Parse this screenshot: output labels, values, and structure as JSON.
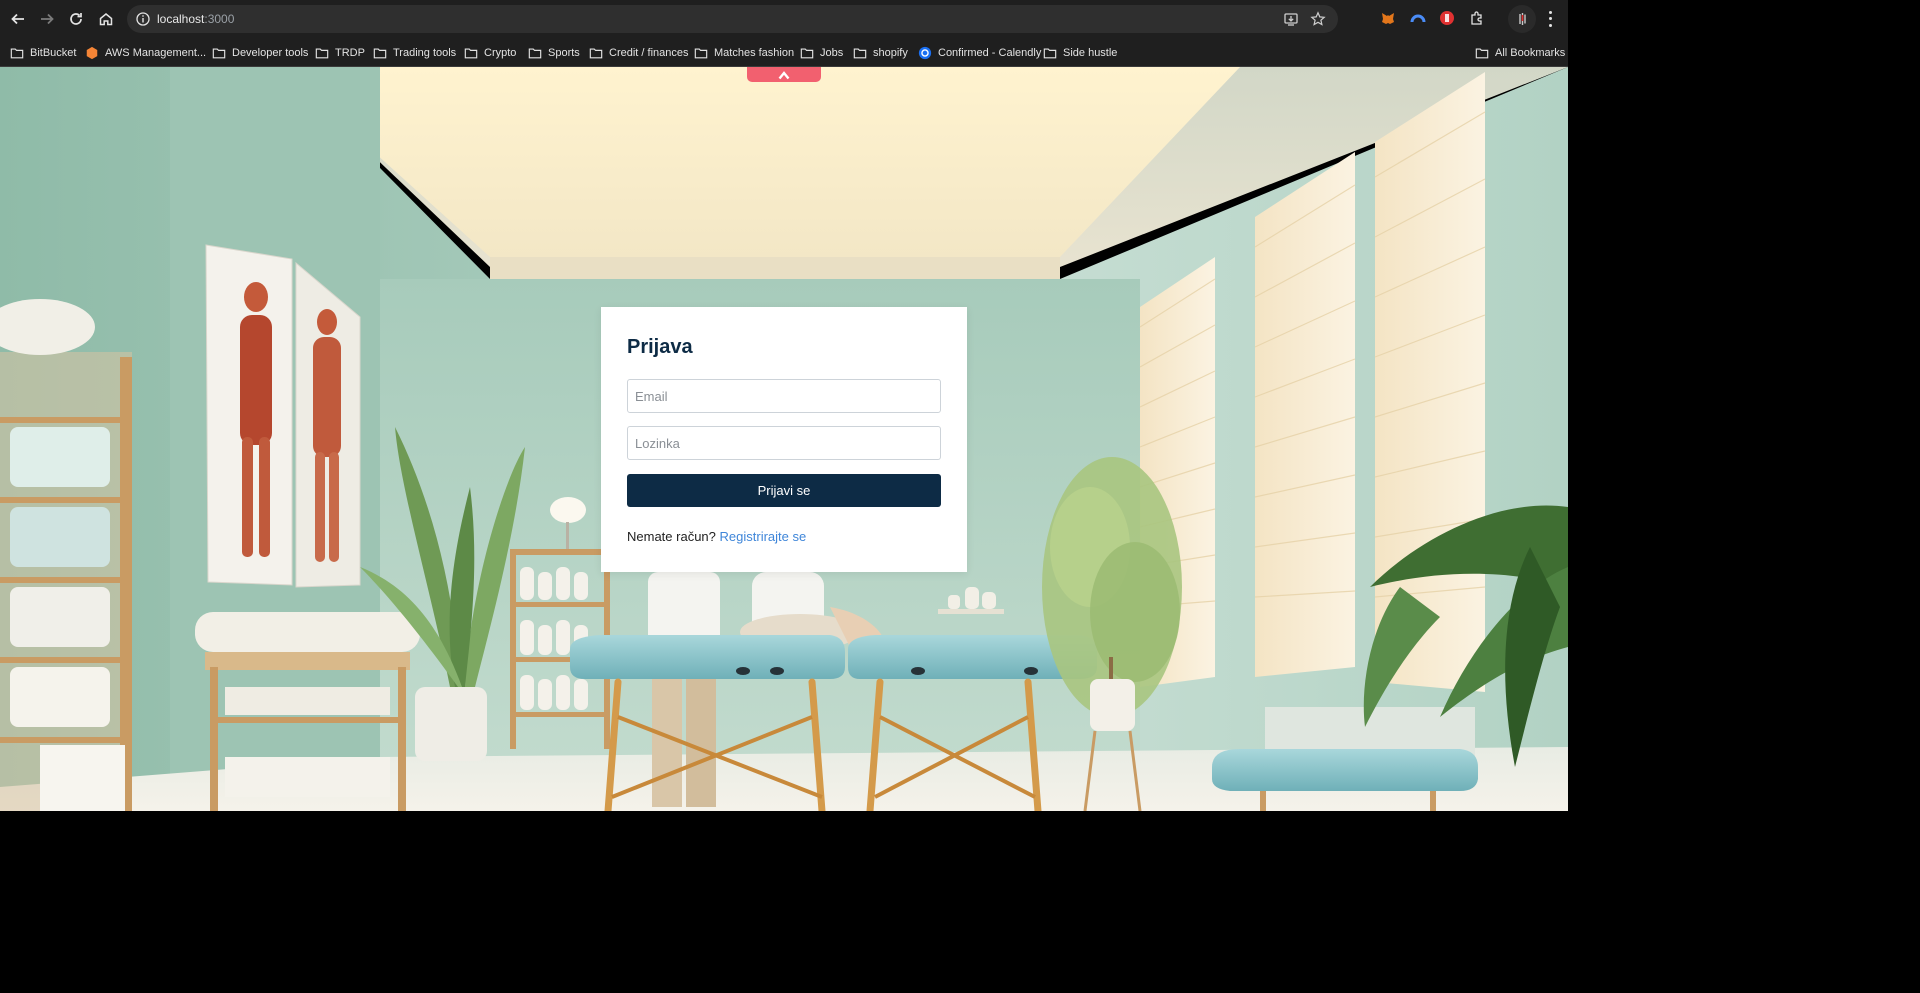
{
  "browser": {
    "url_host": "localhost",
    "url_port": ":3000",
    "bookmarks": [
      {
        "label": "BitBucket",
        "icon": "folder-icon"
      },
      {
        "label": "AWS Management...",
        "icon": "aws-icon"
      },
      {
        "label": "Developer tools",
        "icon": "folder-icon"
      },
      {
        "label": "TRDP",
        "icon": "folder-icon"
      },
      {
        "label": "Trading tools",
        "icon": "folder-icon"
      },
      {
        "label": "Crypto",
        "icon": "folder-icon"
      },
      {
        "label": "Sports",
        "icon": "folder-icon"
      },
      {
        "label": "Credit / finances",
        "icon": "folder-icon"
      },
      {
        "label": "Matches fashion",
        "icon": "folder-icon"
      },
      {
        "label": "Jobs",
        "icon": "folder-icon"
      },
      {
        "label": "shopify",
        "icon": "folder-icon"
      },
      {
        "label": "Confirmed - Calendly",
        "icon": "calendly-icon"
      },
      {
        "label": "Side hustle",
        "icon": "folder-icon"
      }
    ],
    "all_bookmarks": "All Bookmarks"
  },
  "login": {
    "title": "Prijava",
    "email_placeholder": "Email",
    "password_placeholder": "Lozinka",
    "submit_label": "Prijavi se",
    "no_account_text": "Nemate račun?",
    "register_link": "Registrirajte se"
  },
  "colors": {
    "primary": "#0d2b45",
    "link": "#3f86d9",
    "tab_accent": "#f2606f",
    "wall": "#a9cfc0"
  }
}
